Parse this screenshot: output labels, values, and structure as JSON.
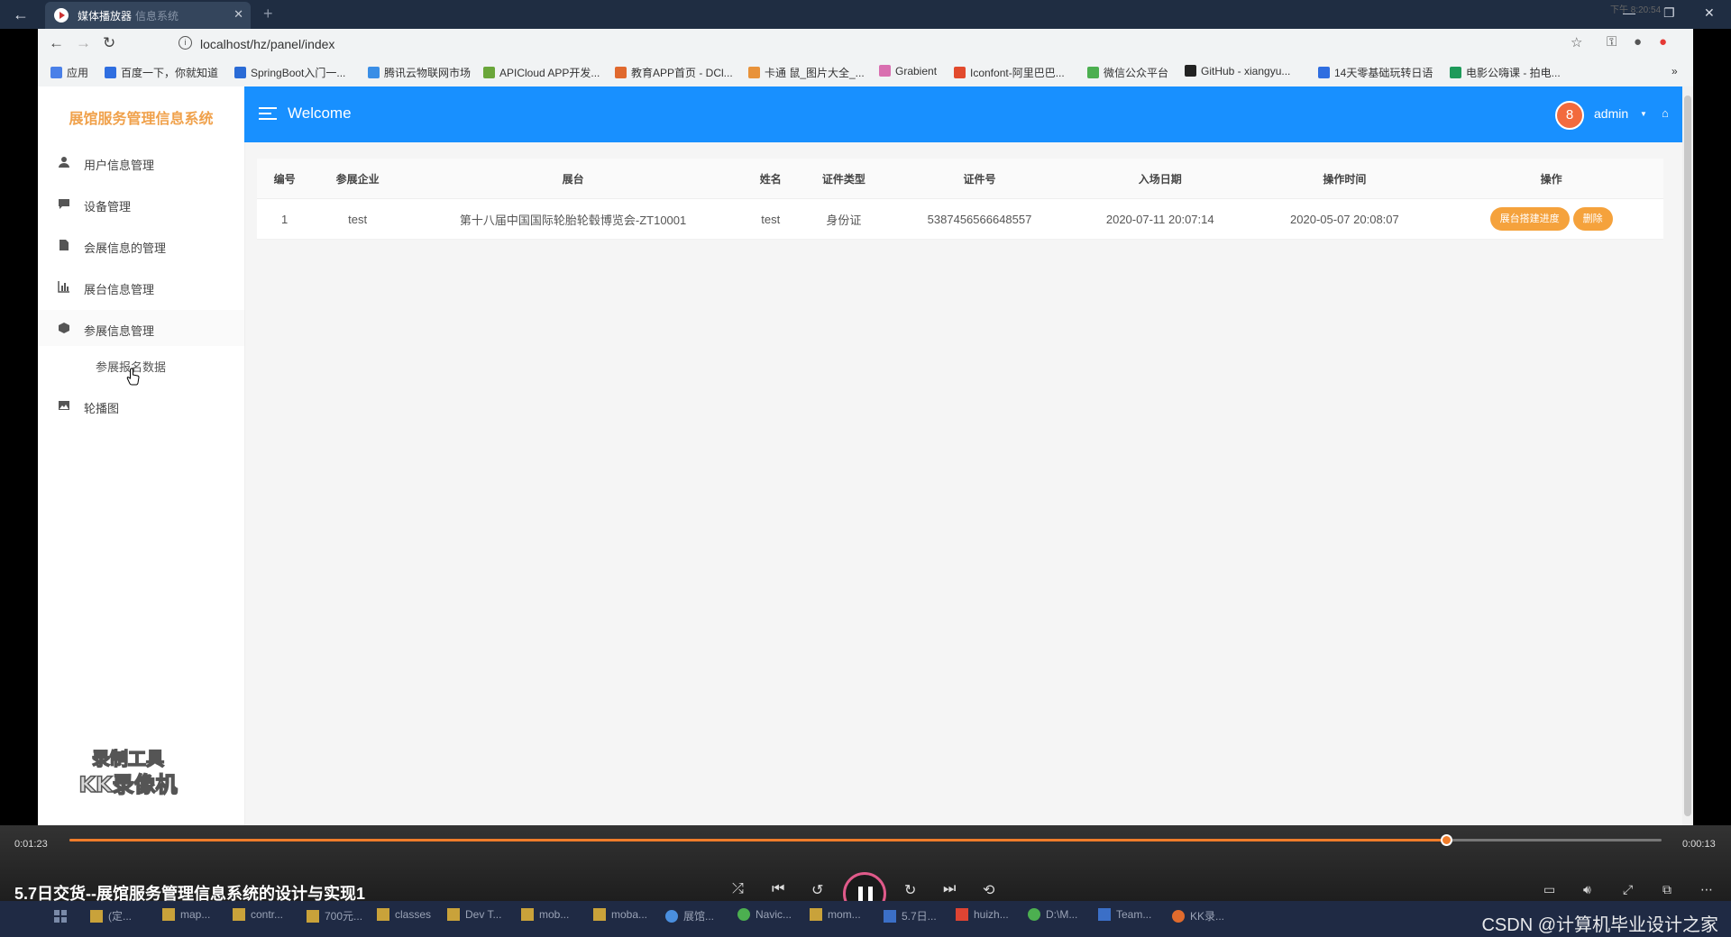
{
  "player_tab": {
    "name": "媒体播放器",
    "subtitle": "信息系统"
  },
  "browser": {
    "url": "localhost/hz/panel/index",
    "bookmarks": [
      {
        "label": "应用",
        "color": "#4a80e8"
      },
      {
        "label": "百度一下，你就知道",
        "color": "#2f6ee0"
      },
      {
        "label": "SpringBoot入门一...",
        "color": "#2a6bd6"
      },
      {
        "label": "腾讯云物联网市场",
        "color": "#3a8ee6"
      },
      {
        "label": "APICloud APP开发...",
        "color": "#6aa63a"
      },
      {
        "label": "教育APP首页 - DCl...",
        "color": "#e0692e"
      },
      {
        "label": "卡通 鼠_图片大全_...",
        "color": "#e8923a"
      },
      {
        "label": "Grabient",
        "color": "#d96fb0"
      },
      {
        "label": "Iconfont-阿里巴巴...",
        "color": "#e24a2d"
      },
      {
        "label": "微信公众平台",
        "color": "#4caf50"
      },
      {
        "label": "GitHub - xiangyu...",
        "color": "#222222"
      },
      {
        "label": "14天零基础玩转日语",
        "color": "#2f6ee0"
      },
      {
        "label": "电影公嗨课 - 拍电...",
        "color": "#1e9a5a"
      }
    ]
  },
  "sidebar": {
    "brand": "展馆服务管理信息系统",
    "items": [
      {
        "label": "用户信息管理",
        "icon": "user-icon"
      },
      {
        "label": "设备管理",
        "icon": "comment-icon"
      },
      {
        "label": "会展信息的管理",
        "icon": "file-icon"
      },
      {
        "label": "展台信息管理",
        "icon": "bar-chart-icon"
      },
      {
        "label": "参展信息管理",
        "icon": "box-icon"
      },
      {
        "label": "轮播图",
        "icon": "image-icon"
      }
    ],
    "submenu": [
      "参展报名数据"
    ]
  },
  "header": {
    "title": "Welcome",
    "user": "admin",
    "avatar_text": "8"
  },
  "table": {
    "columns": [
      "编号",
      "参展企业",
      "展台",
      "姓名",
      "证件类型",
      "证件号",
      "入场日期",
      "操作时间",
      "操作"
    ],
    "rows": [
      {
        "id": "1",
        "company": "test",
        "booth": "第十八届中国国际轮胎轮毂博览会-ZT10001",
        "name": "test",
        "id_type": "身份证",
        "id_number": "5387456566648557",
        "entry_date": "2020-07-11 20:07:14",
        "op_time": "2020-05-07 20:08:07",
        "actions": [
          "展台搭建进度",
          "删除"
        ]
      }
    ]
  },
  "player": {
    "elapsed": "0:01:23",
    "remaining": "0:00:13",
    "progress": 0.8645,
    "video_title": "5.7日交货--展馆服务管理信息系统的设计与实现1",
    "accent": "#f07c2a"
  },
  "watermark": {
    "line1": "录制工具",
    "line2": "KK录像机"
  },
  "taskbar": {
    "items": [
      {
        "label": "(定...",
        "kind": ""
      },
      {
        "label": "map...",
        "kind": ""
      },
      {
        "label": "contr...",
        "kind": ""
      },
      {
        "label": "700元...",
        "kind": ""
      },
      {
        "label": "classes",
        "kind": ""
      },
      {
        "label": "Dev T...",
        "kind": ""
      },
      {
        "label": "mob...",
        "kind": ""
      },
      {
        "label": "moba...",
        "kind": ""
      },
      {
        "label": "展馆...",
        "kind": "chrome-ic"
      },
      {
        "label": "Navic...",
        "kind": "green"
      },
      {
        "label": "mom...",
        "kind": ""
      },
      {
        "label": "5.7日...",
        "kind": "blue"
      },
      {
        "label": "huizh...",
        "kind": "red"
      },
      {
        "label": "D:\\M...",
        "kind": "green"
      },
      {
        "label": "Team...",
        "kind": "blue"
      },
      {
        "label": "KK录...",
        "kind": "orange"
      }
    ],
    "clock": "下午 8:20:54",
    "csdn": "CSDN @计算机毕业设计之家"
  }
}
